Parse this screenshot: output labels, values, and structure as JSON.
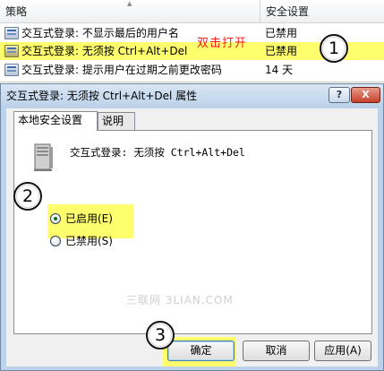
{
  "list": {
    "header": {
      "policy": "策略",
      "setting": "安全设置"
    },
    "rows": [
      {
        "name": "交互式登录: 不显示最后的用户名",
        "value": "已禁用"
      },
      {
        "name": "交互式登录: 无须按 Ctrl+Alt+Del",
        "value": "已禁用"
      },
      {
        "name": "交互式登录: 提示用户在过期之前更改密码",
        "value": "14 天"
      }
    ]
  },
  "annotations": {
    "double_click": "双击打开",
    "step1": "1",
    "step2": "2",
    "step3": "3"
  },
  "dialog": {
    "title": "交互式登录: 无须按 Ctrl+Alt+Del 属性",
    "help": "?",
    "close": "X",
    "tabs": [
      "本地安全设置",
      "说明"
    ],
    "policy_name": "交互式登录: 无须按 Ctrl+Alt+Del",
    "options": [
      {
        "label": "已启用(E)",
        "selected": true
      },
      {
        "label": "已禁用(S)",
        "selected": false
      }
    ],
    "watermark": "三联网 3LIAN.COM",
    "buttons": {
      "ok": "确定",
      "cancel": "取消",
      "apply": "应用(A)"
    }
  },
  "colors": {
    "highlight": "#ffff6e",
    "annotation_red": "#ff1a1a",
    "dialog_frame": "#bcd2ea"
  }
}
